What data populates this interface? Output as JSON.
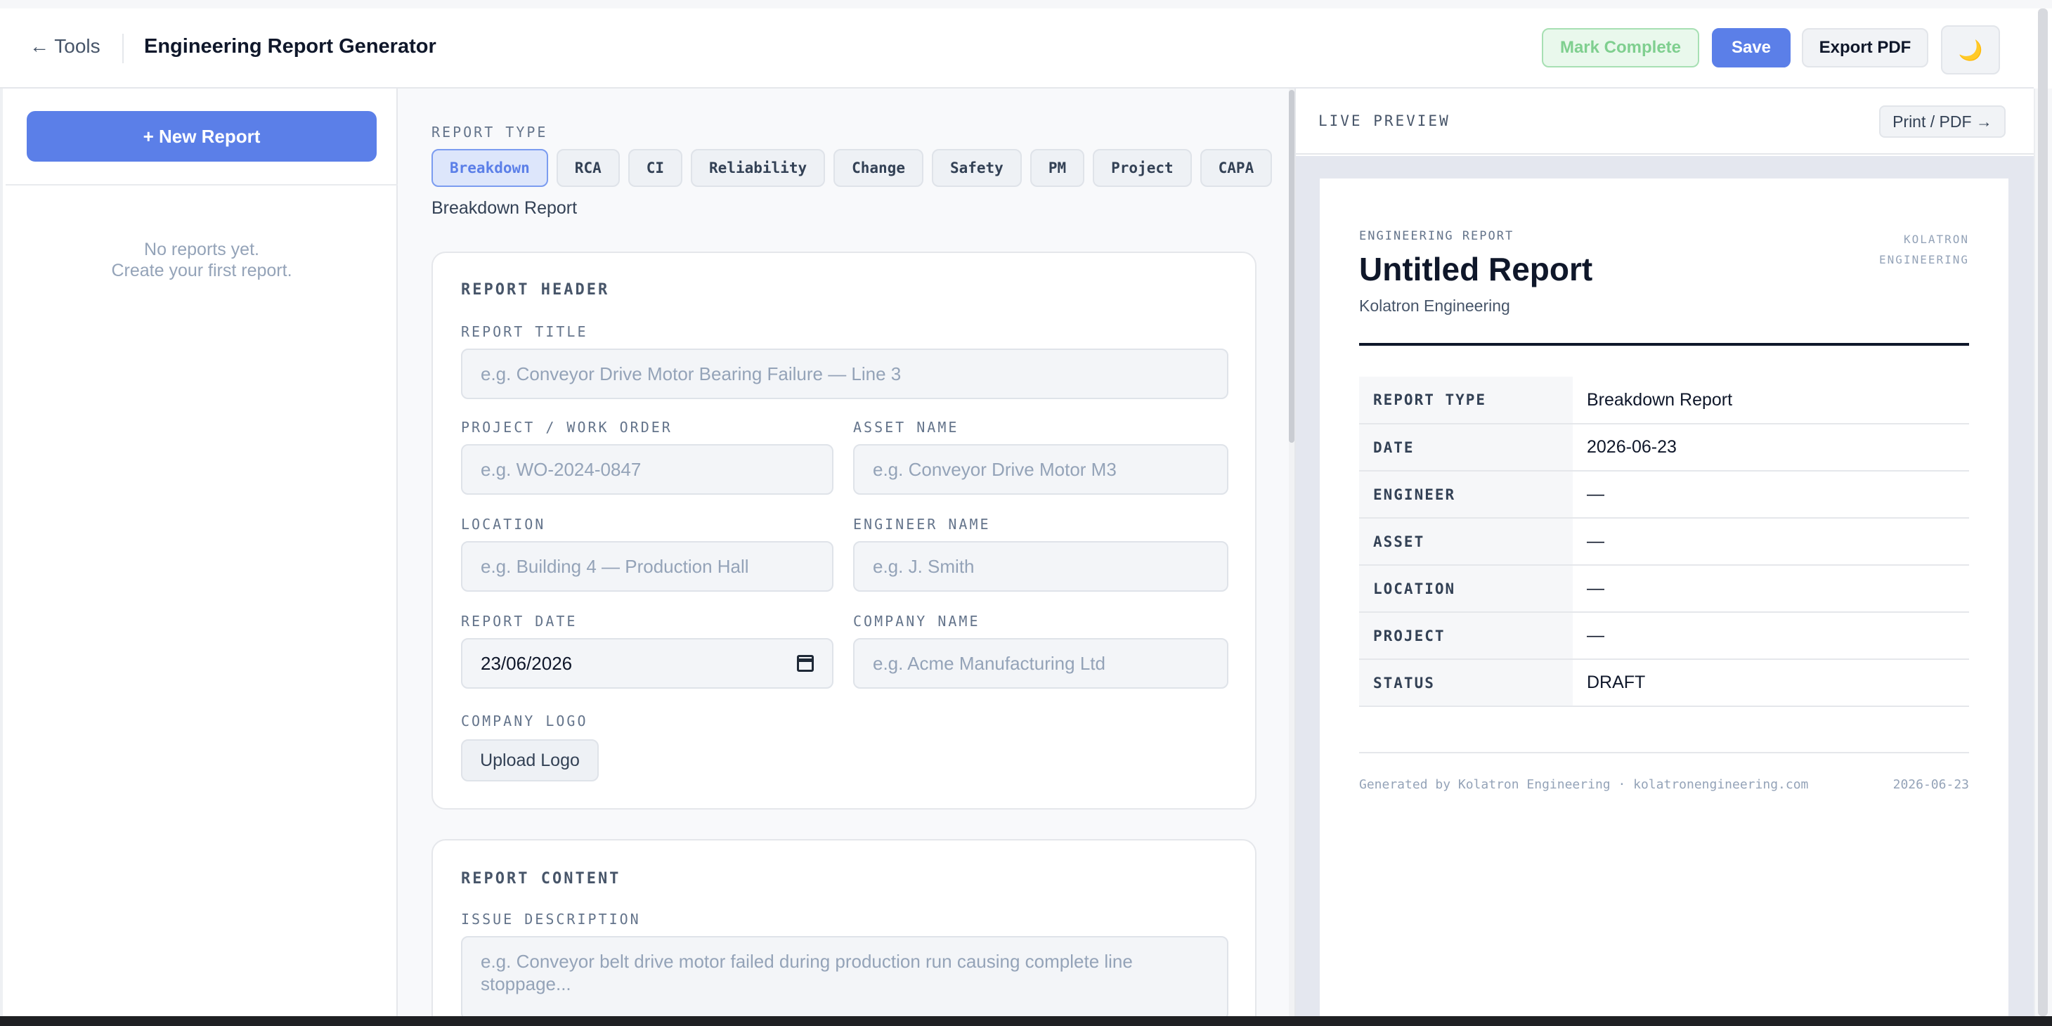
{
  "header": {
    "back_label": "← Tools",
    "app_title": "Engineering Report Generator",
    "mark_complete_label": "Mark Complete",
    "save_label": "Save",
    "export_pdf_label": "Export PDF",
    "theme_icon": "🌙"
  },
  "sidebar": {
    "new_report_label": "+ New Report",
    "empty_line1": "No reports yet.",
    "empty_line2": "Create your first report."
  },
  "editor": {
    "report_type_label": "REPORT TYPE",
    "types": [
      "Breakdown",
      "RCA",
      "CI",
      "Reliability",
      "Change",
      "Safety",
      "PM",
      "Project",
      "CAPA"
    ],
    "active_type": "Breakdown",
    "selected_type_name": "Breakdown Report",
    "header_card": {
      "title": "REPORT HEADER",
      "report_title_label": "REPORT TITLE",
      "report_title_placeholder": "e.g. Conveyor Drive Motor Bearing Failure — Line 3",
      "project_label": "PROJECT / WORK ORDER",
      "project_placeholder": "e.g. WO-2024-0847",
      "asset_label": "ASSET NAME",
      "asset_placeholder": "e.g. Conveyor Drive Motor M3",
      "location_label": "LOCATION",
      "location_placeholder": "e.g. Building 4 — Production Hall",
      "engineer_label": "ENGINEER NAME",
      "engineer_placeholder": "e.g. J. Smith",
      "date_label": "REPORT DATE",
      "date_value": "23/06/2026",
      "company_label": "COMPANY NAME",
      "company_placeholder": "e.g. Acme Manufacturing Ltd",
      "logo_label": "COMPANY LOGO",
      "upload_label": "Upload Logo"
    },
    "content_card": {
      "title": "REPORT CONTENT",
      "issue_label": "ISSUE DESCRIPTION",
      "issue_placeholder": "e.g. Conveyor belt drive motor failed during production run causing complete line stoppage..."
    }
  },
  "preview": {
    "label": "LIVE PREVIEW",
    "print_label": "Print / PDF →",
    "eyebrow": "ENGINEERING REPORT",
    "title": "Untitled Report",
    "company": "Kolatron Engineering",
    "brand_line1": "KOLATRON",
    "brand_line2": "ENGINEERING",
    "rows": [
      {
        "key": "REPORT TYPE",
        "value": "Breakdown Report"
      },
      {
        "key": "DATE",
        "value": "2026-06-23"
      },
      {
        "key": "ENGINEER",
        "value": "—"
      },
      {
        "key": "ASSET",
        "value": "—"
      },
      {
        "key": "LOCATION",
        "value": "—"
      },
      {
        "key": "PROJECT",
        "value": "—"
      },
      {
        "key": "STATUS",
        "value": "DRAFT"
      }
    ],
    "footer_text": "Generated by Kolatron Engineering · kolatronengineering.com",
    "footer_date": "2026-06-23"
  },
  "colors": {
    "accent": "#5b7fe8",
    "complete_text": "#7fcf8f",
    "preview_bg": "#e4e7ef"
  }
}
